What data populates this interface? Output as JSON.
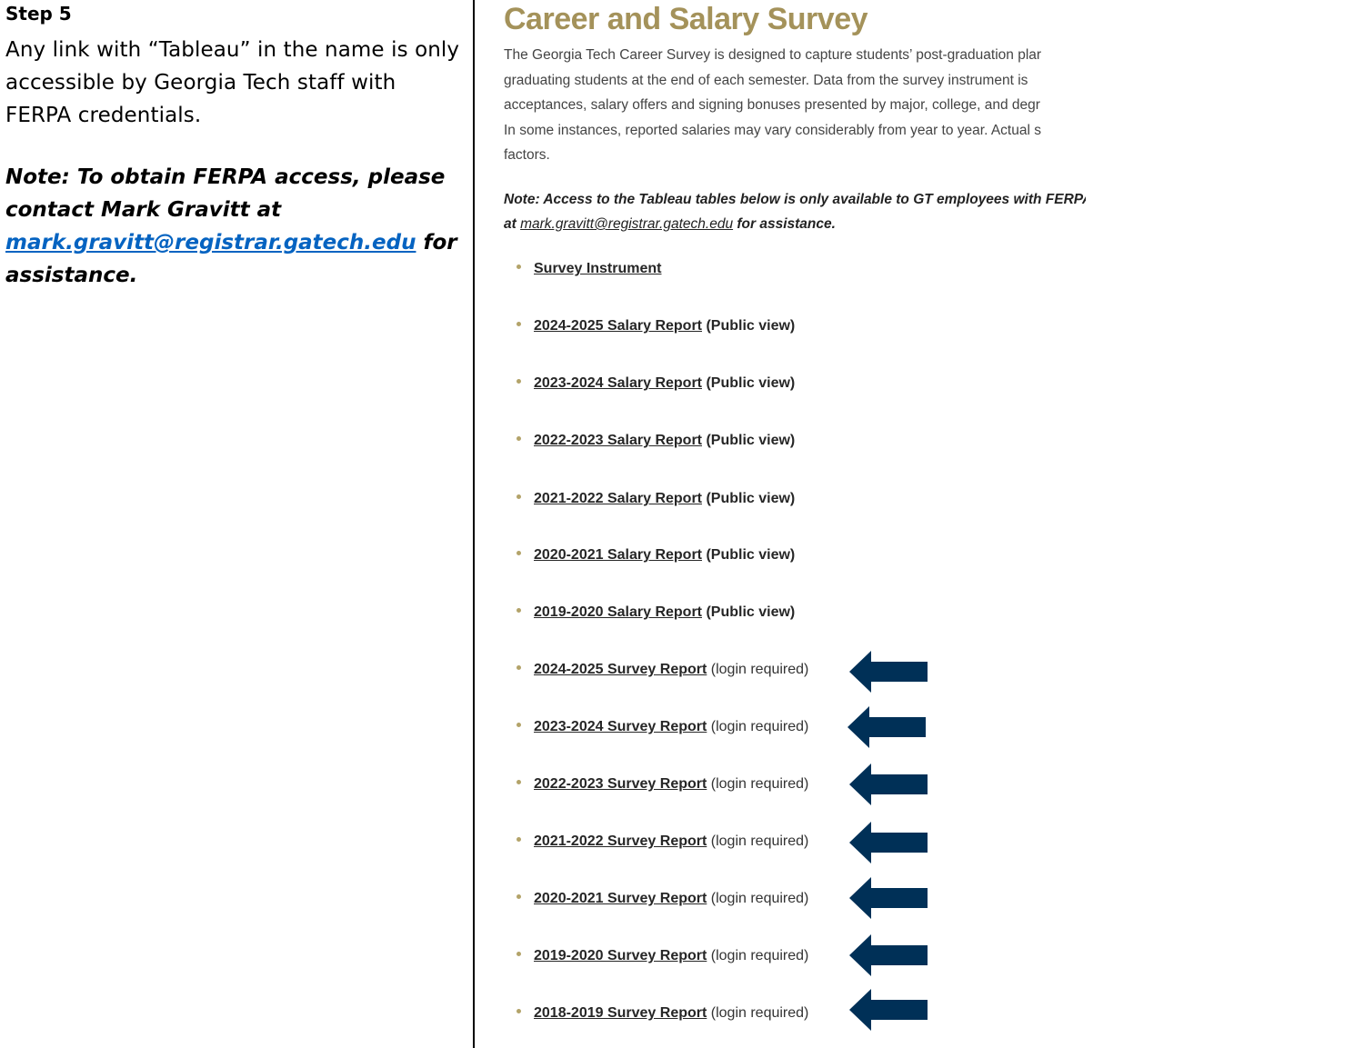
{
  "instructions": {
    "step_title": "Step 5",
    "step_body": "Any link with “Tableau” in the name is only accessible by Georgia Tech staff with FERPA credentials.",
    "note_prefix": "Note:  To obtain FERPA access, please contact Mark Gravitt at ",
    "note_email": "mark.gravitt@registrar.gatech.edu",
    "note_suffix": " for assistance."
  },
  "page": {
    "title": "Career and Salary Survey",
    "intro_lines": [
      "The Georgia Tech Career Survey is designed to capture students’ post-graduation plar",
      "graduating students at the end of each semester. Data from the survey instrument is ",
      "acceptances, salary offers and signing bonuses presented by major, college, and degr",
      "In some instances, reported salaries may vary considerably from year to year. Actual s",
      "factors."
    ],
    "access_note_prefix": "Note: Access to the Tableau tables below is only available to GT employees with FERPA",
    "access_note_at": "at ",
    "access_note_email": "mark.gravitt@registrar.gatech.edu",
    "access_note_suffix": " for assistance.",
    "links": [
      {
        "label": "Survey Instrument",
        "suffix": ""
      },
      {
        "label": "2024-2025 Salary Report",
        "suffix": " (Public view)"
      },
      {
        "label": "2023-2024 Salary Report",
        "suffix": " (Public view)"
      },
      {
        "label": "2022-2023 Salary Report",
        "suffix": " (Public view)"
      },
      {
        "label": "2021-2022 Salary Report",
        "suffix": " (Public view)"
      },
      {
        "label": "2020-2021 Salary Report",
        "suffix": " (Public view)"
      },
      {
        "label": "2019-2020 Salary Report",
        "suffix": " (Public view)"
      },
      {
        "label": "2024-2025 Survey Report",
        "suffix": " (login required)"
      },
      {
        "label": "2023-2024 Survey Report",
        "suffix": " (login required)"
      },
      {
        "label": "2022-2023 Survey Report",
        "suffix": " (login required)"
      },
      {
        "label": "2021-2022 Survey Report",
        "suffix": " (login required)"
      },
      {
        "label": "2020-2021 Survey Report",
        "suffix": " (login required)"
      },
      {
        "label": "2019-2020 Survey Report",
        "suffix": " (login required)"
      },
      {
        "label": "2018-2019 Survey Report",
        "suffix": " (login required)"
      }
    ]
  },
  "colors": {
    "title_gold": "#a4925a",
    "bullet_gold": "#b3a369",
    "arrow_navy": "#003057",
    "email_link_blue": "#0563c1"
  },
  "icons": {
    "arrow": "left-arrow-icon"
  }
}
